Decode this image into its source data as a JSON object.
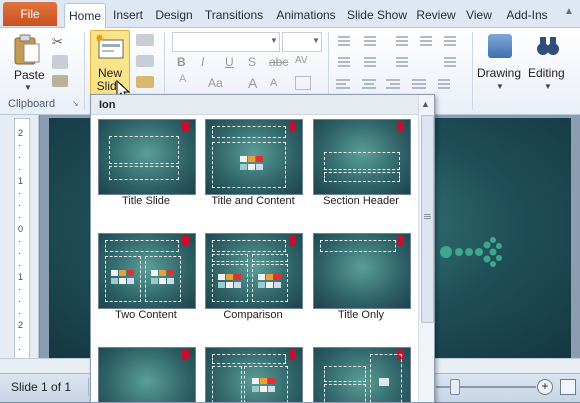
{
  "tabs": {
    "file": "File",
    "items": [
      "Home",
      "Insert",
      "Design",
      "Transitions",
      "Animations",
      "Slide Show",
      "Review",
      "View",
      "Add-Ins"
    ]
  },
  "ribbon": {
    "paste_label": "Paste",
    "new_slide_label_1": "New",
    "new_slide_label_2": "Slide",
    "clipboard_group": "Clipboard",
    "drawing_label": "Drawing",
    "editing_label": "Editing",
    "font_buttons": [
      "B",
      "I",
      "U",
      "S",
      "abc",
      "AV"
    ],
    "grow_font": "A",
    "shrink_font": "A",
    "clear_font": "Aa"
  },
  "gallery": {
    "title": "Ion",
    "layouts": [
      "Title Slide",
      "Title and Content",
      "Section Header",
      "Two Content",
      "Comparison",
      "Title Only"
    ]
  },
  "status": {
    "slide_info": "Slide 1 of 1"
  },
  "colors": {
    "file_tab": "#d55a28",
    "slide_bg": "#1f4f58",
    "accent_red": "#c8102e",
    "highlight": "#fbe38a"
  }
}
